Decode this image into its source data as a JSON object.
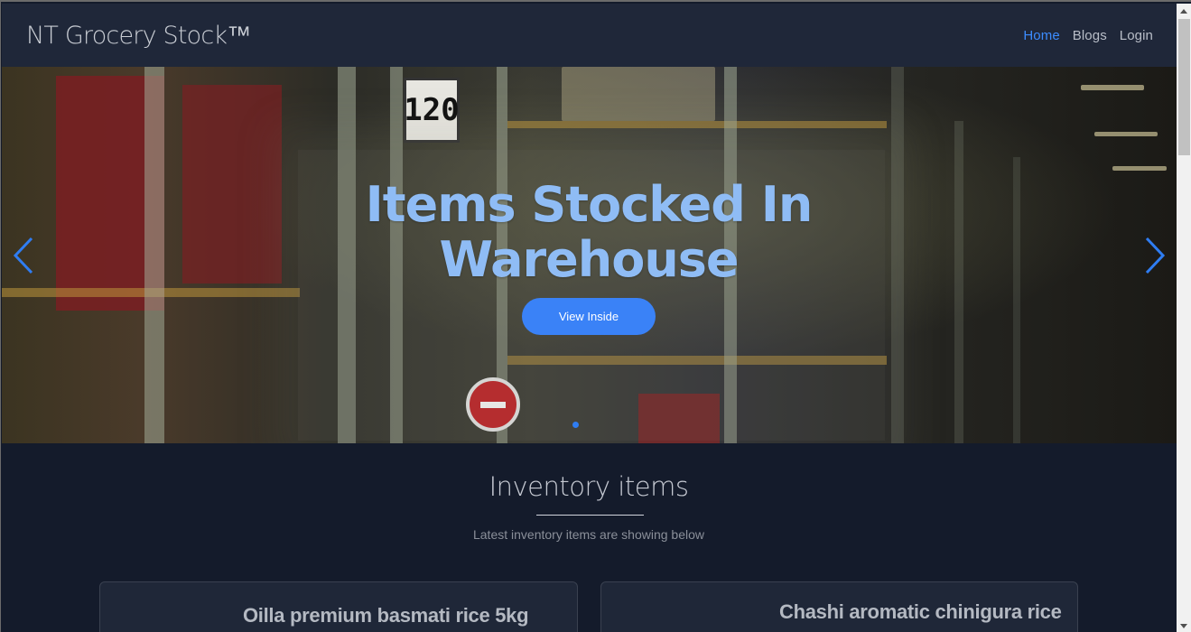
{
  "navbar": {
    "brand": "NT Grocery Stock™",
    "links": [
      {
        "label": "Home",
        "active": true
      },
      {
        "label": "Blogs",
        "active": false
      },
      {
        "label": "Login",
        "active": false
      }
    ]
  },
  "hero": {
    "sign_number": "120",
    "title": "Items Stocked In Warehouse",
    "button_label": "View Inside"
  },
  "inventory": {
    "title": "Inventory items",
    "subtitle": "Latest inventory items are showing below",
    "cards": [
      {
        "title": "Oilla premium basmati rice 5kg"
      },
      {
        "title": "Chashi aromatic chinigura rice"
      }
    ]
  },
  "colors": {
    "accent": "#3a82f7",
    "nav_background": "#1f2739",
    "page_background": "#141b2b",
    "hero_title": "#8fbcf5"
  }
}
